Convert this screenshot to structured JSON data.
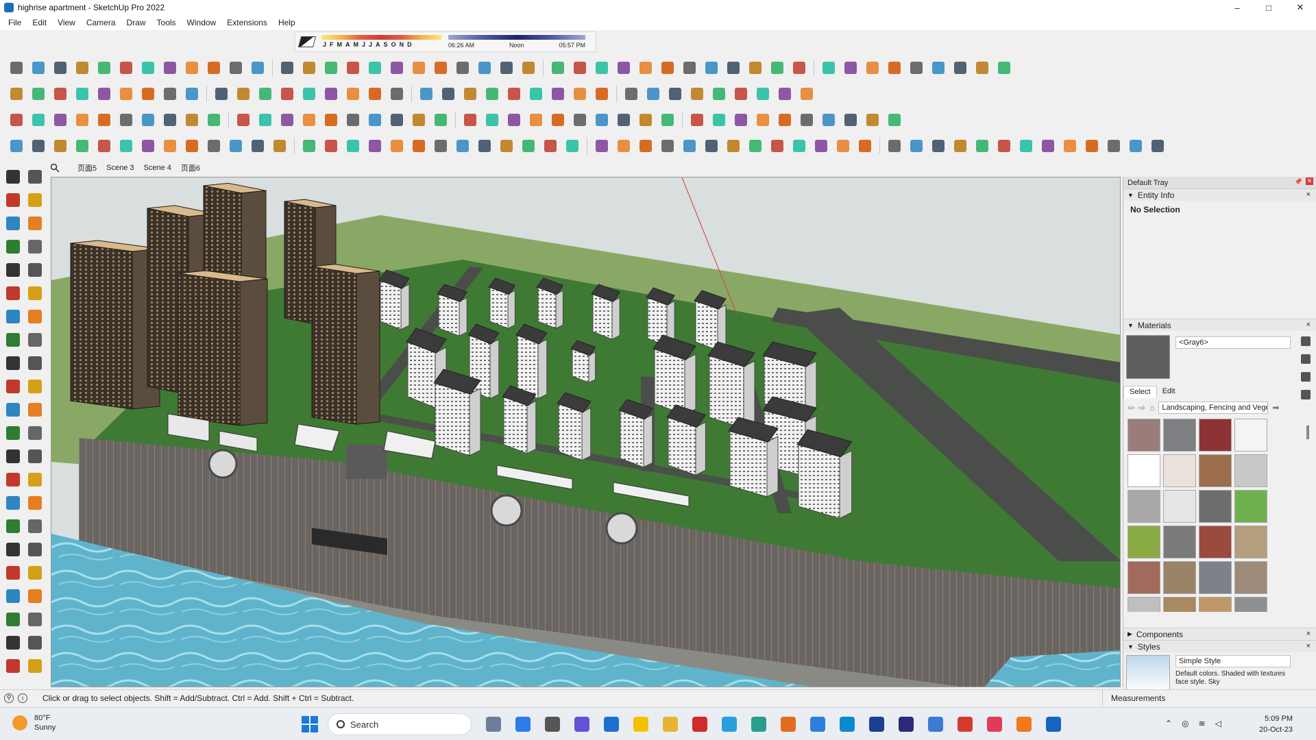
{
  "window": {
    "title": "highrise apartment - SketchUp Pro 2022",
    "controls": {
      "minimize": "–",
      "maximize": "□",
      "close": "✕"
    }
  },
  "menu": [
    "File",
    "Edit",
    "View",
    "Camera",
    "Draw",
    "Tools",
    "Window",
    "Extensions",
    "Help"
  ],
  "shadows": {
    "months": [
      "J",
      "F",
      "M",
      "A",
      "M",
      "J",
      "J",
      "A",
      "S",
      "O",
      "N",
      "D"
    ],
    "time_start": "06:26 AM",
    "time_mid": "Noon",
    "time_end": "05:57 PM"
  },
  "scenes": {
    "tabs": [
      "页面5",
      "Scene 3",
      "Scene 4",
      "页面6"
    ]
  },
  "tray": {
    "title": "Default Tray",
    "entity_info": {
      "header": "Entity Info",
      "value": "No Selection"
    },
    "materials": {
      "header": "Materials",
      "current": "<Gray6>",
      "current_color": "#5f5f5f",
      "tab_select": "Select",
      "tab_edit": "Edit",
      "collection": "Landscaping, Fencing and Vegetation",
      "swatches": [
        "#9a7d7a",
        "#7d7f82",
        "#8d3335",
        "#f4f4f4",
        "#ffffff",
        "#e9e2dd",
        "#9c6e4d",
        "#c8c8c8",
        "#a8a8a8",
        "#e6e6e6",
        "#6d6d6d",
        "#6fb14e",
        "#8bab45",
        "#7a7a7a",
        "#9b4a3e",
        "#b49e7e",
        "#a26a5c",
        "#9a8468",
        "#7d8188",
        "#9d8a78",
        "#bfbfbf",
        "#a98a60",
        "#c09868",
        "#8f8f8f"
      ]
    },
    "components": {
      "header": "Components"
    },
    "styles": {
      "header": "Styles",
      "name": "Simple Style",
      "description": "Default colors. Shaded with textures face style. Sky"
    }
  },
  "status": {
    "message": "Click or drag to select objects. Shift = Add/Subtract. Ctrl = Add. Shift + Ctrl = Subtract.",
    "measurements": "Measurements"
  },
  "taskbar": {
    "weather_temp": "80°F",
    "weather_desc": "Sunny",
    "search_placeholder": "Search",
    "time": "5:09 PM",
    "date": "20-Oct-23"
  },
  "colors": {
    "grass": "#3f7a34",
    "light_grass": "#8aa865",
    "water": "#5fb4cc",
    "road": "#4a4d4a"
  }
}
